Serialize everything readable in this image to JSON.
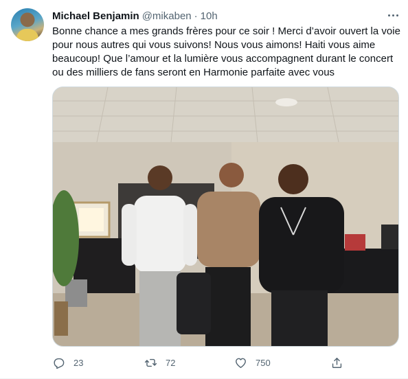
{
  "tweet": {
    "author_name": "Michael Benjamin",
    "handle": "@mikaben",
    "separator": "·",
    "time": "10h",
    "text": "Bonne chance a mes grands frères pour ce soir ! Merci d’avoir ouvert la voie\npour nous autres qui vous suivons! Nous vous aimons! Haiti vous aime\nbeaucoup! Que l’amour et la lumière vous accompagnent durant le concert\nou des milliers de fans seront en Harmonie parfaite avec vous"
  },
  "actions": {
    "reply_count": "23",
    "retweet_count": "72",
    "like_count": "750"
  },
  "icons": {
    "more": "more-horizontal-icon",
    "reply": "reply-icon",
    "retweet": "retweet-icon",
    "like": "heart-icon",
    "share": "share-icon"
  },
  "colors": {
    "text_primary": "#0f1419",
    "text_secondary": "#536471",
    "border": "#cfd9de"
  }
}
